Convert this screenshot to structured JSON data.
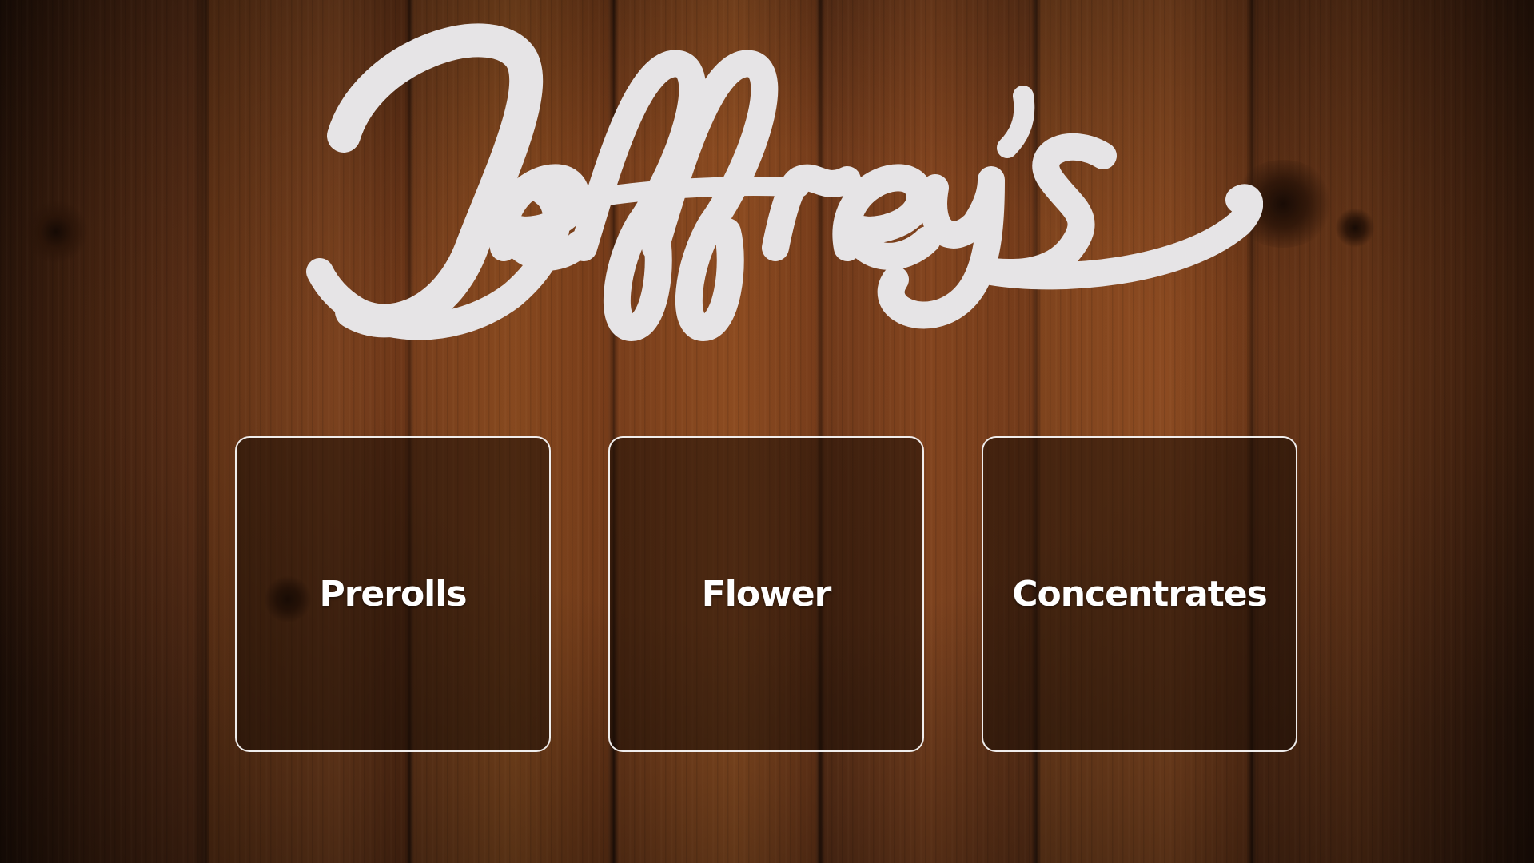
{
  "brand": {
    "logo_text": "Jeffrey's",
    "logo_color": "#e6e4e6"
  },
  "menu": {
    "categories": [
      {
        "label": "Prerolls"
      },
      {
        "label": "Flower"
      },
      {
        "label": "Concentrates"
      }
    ]
  },
  "theme": {
    "tile_border": "#ffffff",
    "text_color": "#ffffff",
    "background": "wood-planks"
  }
}
